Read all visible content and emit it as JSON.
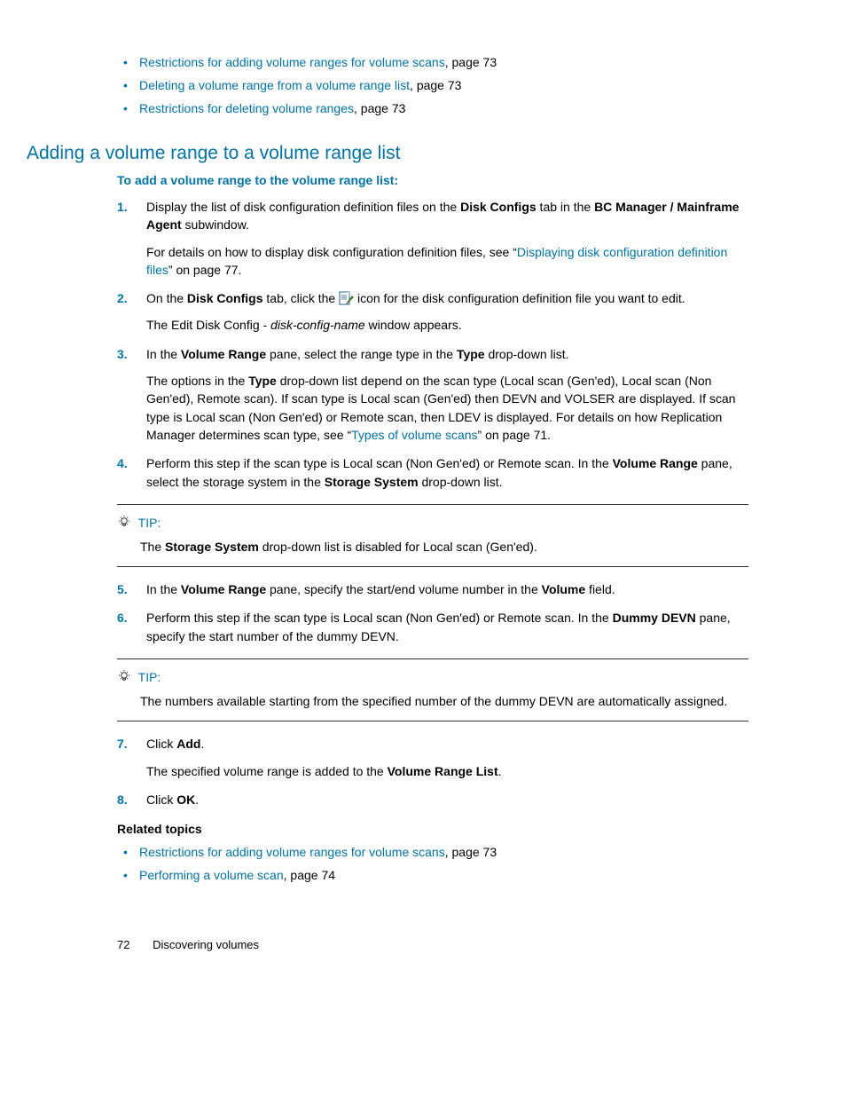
{
  "intro_bullets": [
    {
      "link": "Restrictions for adding volume ranges for volume scans",
      "suffix": ", page 73"
    },
    {
      "link": "Deleting a volume range from a volume range list",
      "suffix": ", page 73"
    },
    {
      "link": "Restrictions for deleting volume ranges",
      "suffix": ", page 73"
    }
  ],
  "heading": "Adding a volume range to a volume range list",
  "subheading": "To add a volume range to the volume range list:",
  "steps": {
    "s1": {
      "t1": "Display the list of disk configuration definition files on the ",
      "b1": "Disk Configs",
      "t2": " tab in the ",
      "b2": "BC Manager / Mainframe Agent",
      "t3": " subwindow.",
      "d_t1": "For details on how to display disk configuration definition files, see “",
      "d_link": "Displaying disk configuration definition files",
      "d_t2": "” on page 77."
    },
    "s2": {
      "t1": "On the ",
      "b1": "Disk Configs",
      "t2": " tab, click the ",
      "t3": " icon for the disk configuration definition file you want to edit.",
      "d_t1": "The Edit Disk Config - ",
      "d_i1": "disk-config-name",
      "d_t2": " window appears."
    },
    "s3": {
      "t1": "In the ",
      "b1": "Volume Range",
      "t2": " pane, select the range type in the ",
      "b2": "Type",
      "t3": " drop-down list.",
      "d_t1": "The options in the ",
      "d_b1": "Type",
      "d_t2": " drop-down list depend on the scan type (Local scan (Gen'ed), Local scan (Non Gen'ed), Remote scan). If scan type is Local scan (Gen'ed) then DEVN and VOLSER are displayed. If scan type is Local scan (Non Gen'ed) or Remote scan, then LDEV is displayed. For details on how Replication Manager determines scan type, see “",
      "d_link": "Types of volume scans",
      "d_t3": "” on page 71."
    },
    "s4": {
      "t1": "Perform this step if the scan type is Local scan (Non Gen'ed) or Remote scan. In the ",
      "b1": "Volume Range",
      "t2": " pane, select the storage system in the ",
      "b2": "Storage System",
      "t3": " drop-down list."
    },
    "s5": {
      "t1": "In the ",
      "b1": "Volume Range",
      "t2": " pane, specify the start/end volume number in the ",
      "b2": "Volume",
      "t3": " field."
    },
    "s6": {
      "t1": "Perform this step if the scan type is Local scan (Non Gen'ed) or Remote scan. In the ",
      "b1": "Dummy DEVN",
      "t2": " pane, specify the start number of the dummy DEVN."
    },
    "s7": {
      "t1": "Click ",
      "b1": "Add",
      "t2": ".",
      "d_t1": "The specified volume range is added to the ",
      "d_b1": "Volume Range List",
      "d_t2": "."
    },
    "s8": {
      "t1": "Click ",
      "b1": "OK",
      "t2": "."
    }
  },
  "tip1": {
    "label": "TIP:",
    "t1": "The ",
    "b1": "Storage System",
    "t2": " drop-down list is disabled for Local scan (Gen'ed)."
  },
  "tip2": {
    "label": "TIP:",
    "text": "The numbers available starting from the specified number of the dummy DEVN are automatically assigned."
  },
  "related_heading": "Related topics",
  "related": [
    {
      "link": "Restrictions for adding volume ranges for volume scans",
      "suffix": ", page 73"
    },
    {
      "link": "Performing a volume scan",
      "suffix": ", page 74"
    }
  ],
  "footer": {
    "page": "72",
    "section": "Discovering volumes"
  }
}
